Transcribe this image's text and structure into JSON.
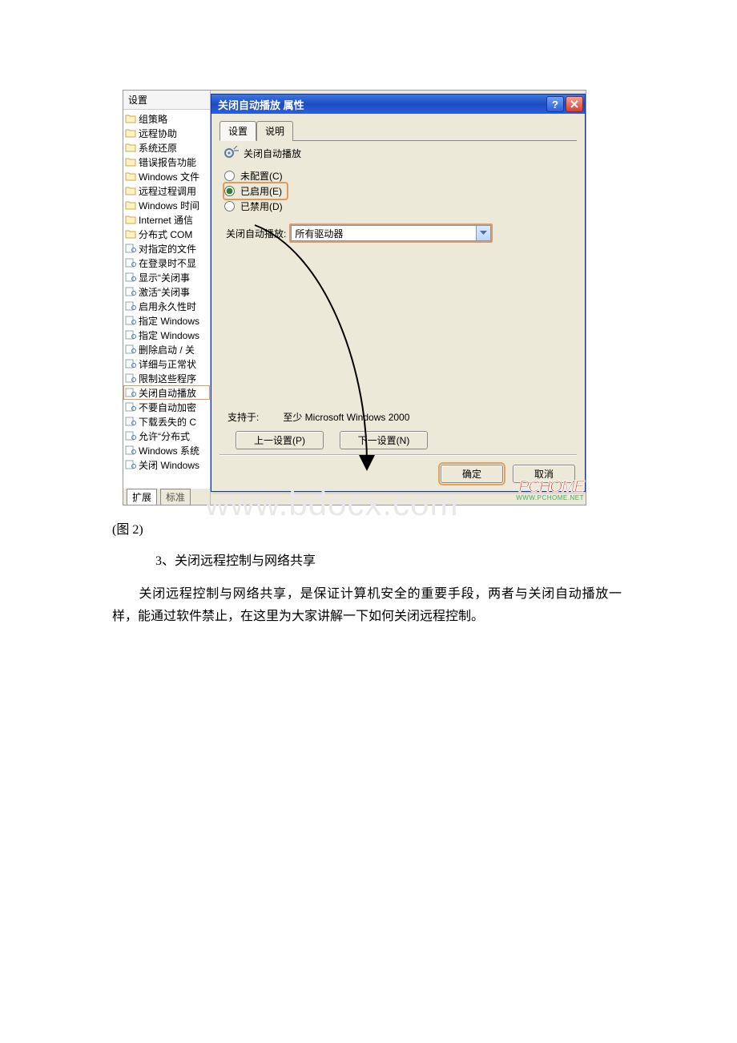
{
  "left_panel": {
    "header": "设置",
    "items": [
      {
        "label": "组策略",
        "type": "folder"
      },
      {
        "label": "远程协助",
        "type": "folder"
      },
      {
        "label": "系统还原",
        "type": "folder"
      },
      {
        "label": "错误报告功能",
        "type": "folder"
      },
      {
        "label": "Windows 文件",
        "type": "folder"
      },
      {
        "label": "远程过程调用",
        "type": "folder"
      },
      {
        "label": "Windows 时间",
        "type": "folder"
      },
      {
        "label": "Internet 通信",
        "type": "folder"
      },
      {
        "label": "分布式 COM",
        "type": "folder"
      },
      {
        "label": "对指定的文件",
        "type": "setting"
      },
      {
        "label": "在登录时不显",
        "type": "setting"
      },
      {
        "label": "显示“关闭事",
        "type": "setting"
      },
      {
        "label": "激活“关闭事",
        "type": "setting"
      },
      {
        "label": "启用永久性时",
        "type": "setting"
      },
      {
        "label": "指定 Windows",
        "type": "setting"
      },
      {
        "label": "指定 Windows",
        "type": "setting"
      },
      {
        "label": "删除启动 / 关",
        "type": "setting"
      },
      {
        "label": "详细与正常状",
        "type": "setting"
      },
      {
        "label": "限制这些程序",
        "type": "setting"
      },
      {
        "label": "关闭自动播放",
        "type": "setting",
        "selected": true
      },
      {
        "label": "不要自动加密",
        "type": "setting"
      },
      {
        "label": "下载丢失的 C",
        "type": "setting"
      },
      {
        "label": "允许“分布式",
        "type": "setting"
      },
      {
        "label": "Windows 系统",
        "type": "setting"
      },
      {
        "label": "关闭 Windows",
        "type": "setting"
      }
    ],
    "footer_tabs": {
      "extended": "扩展",
      "standard": "标准"
    }
  },
  "dialog": {
    "title": "关闭自动播放 属性",
    "tabs": {
      "settings": "设置",
      "explain": "说明"
    },
    "setting_label": "关闭自动播放",
    "radios": {
      "not_configured": "未配置(C)",
      "enabled": "已启用(E)",
      "disabled": "已禁用(D)"
    },
    "field_label": "关闭自动播放:",
    "field_value": "所有驱动器",
    "support_label": "支持于:",
    "support_value": "至少 Microsoft Windows 2000",
    "prev": "上一设置(P)",
    "next": "下一设置(N)",
    "ok": "确定",
    "cancel": "取消"
  },
  "pchome": {
    "logo": "PCHOME",
    "tag": "WWW.PCHOME.NET"
  },
  "watermark": "www.bdocx.com",
  "article": {
    "caption": "(图 2)",
    "section_title": "3、关闭远程控制与网络共享",
    "paragraph_indent": "　　关闭远程控制与网络共享，是保证计算机安全的重要手段，两者与关闭自动播放一样，能通过软件禁止，在这里为大家讲解一下如何关闭远程控制。"
  }
}
